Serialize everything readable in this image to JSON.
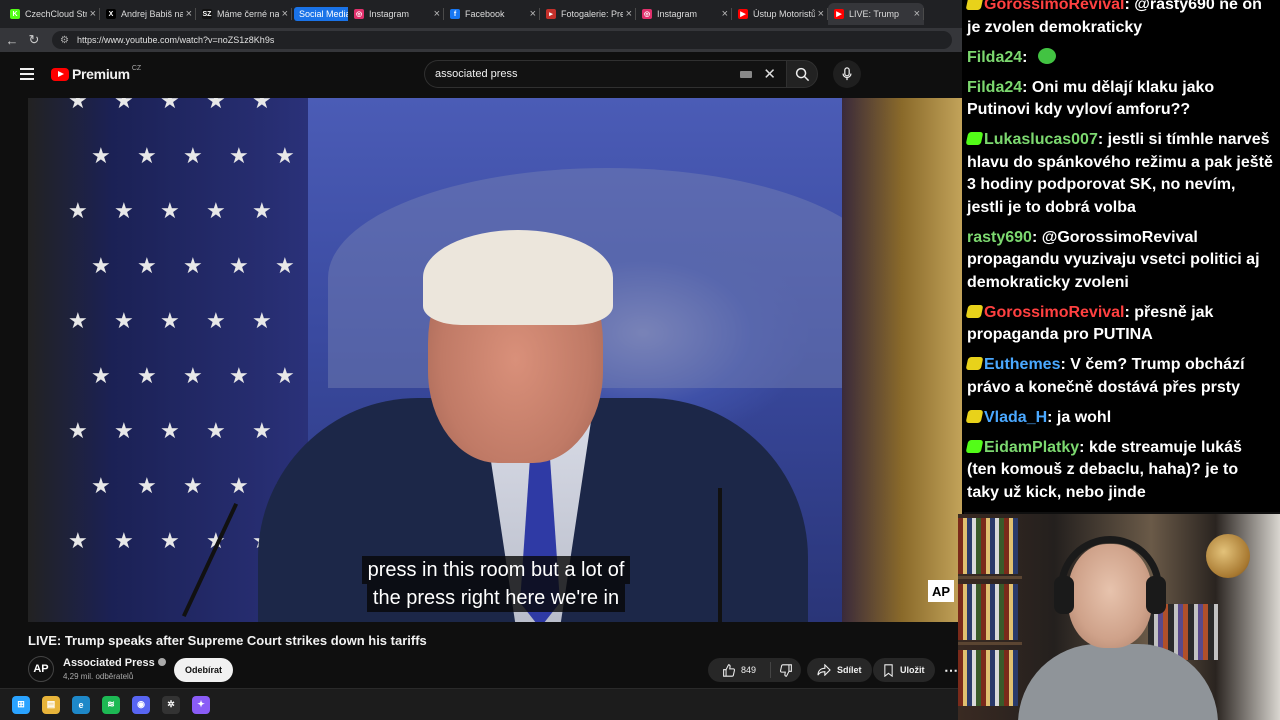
{
  "browser": {
    "tabs": [
      {
        "label": "CzechCloud Stre",
        "icon_color": "#53fc18",
        "glyph": "K"
      },
      {
        "label": "Andrej Babiš na",
        "icon_color": "#000000",
        "glyph": "X"
      },
      {
        "label": "Máme černé na",
        "icon_color": "#111111",
        "glyph": "SZ"
      },
      {
        "label": "Social Media",
        "group": true
      },
      {
        "label": "Instagram",
        "icon_color": "#e1306c",
        "glyph": "◎"
      },
      {
        "label": "Facebook",
        "icon_color": "#1877f2",
        "glyph": "f"
      },
      {
        "label": "Fotogalerie: Prez",
        "icon_color": "#c4302b",
        "glyph": "▸"
      },
      {
        "label": "Instagram",
        "icon_color": "#e1306c",
        "glyph": "◎"
      },
      {
        "label": "Ústup Motoristů",
        "icon_color": "#ff0000",
        "glyph": "▶"
      },
      {
        "label": "LIVE: Trump",
        "icon_color": "#ff0000",
        "glyph": "▶",
        "active": true
      }
    ],
    "url": "https://www.youtube.com/watch?v=noZS1z8Kh9s"
  },
  "youtube": {
    "logo": "Premium",
    "country": "CZ",
    "search_query": "associated press"
  },
  "video": {
    "captions": [
      "press in this room but a lot of",
      "the press right here we're in"
    ],
    "watermark": "AP",
    "title": "LIVE: Trump speaks after Supreme Court strikes down his tariffs"
  },
  "channel": {
    "avatar": "AP",
    "name": "Associated Press",
    "subscribers": "4,29 mil. odběratelů",
    "subscribe_label": "Odebírat"
  },
  "actions": {
    "likes": "849",
    "share": "Sdílet",
    "save": "Uložit",
    "more": "⋯"
  },
  "chat": [
    {
      "user": "GorossimoRevival",
      "color": "#ff4040",
      "badge": "#e8d21a",
      "text": "@rasty690 ne on je zvolen demokraticky"
    },
    {
      "user": "Filda24",
      "color": "#7cd86f",
      "text": "",
      "emote": true
    },
    {
      "user": "Filda24",
      "color": "#7cd86f",
      "text": "Oni mu dělají klaku jako Putinovi kdy vyloví amforu??"
    },
    {
      "user": "Lukaslucas007",
      "color": "#7cd86f",
      "badge": "#53fc18",
      "text": "jestli si tímhle narveš hlavu do spánkového režimu a pak ještě 3 hodiny podporovat SK, no nevím, jestli je to dobrá volba"
    },
    {
      "user": "rasty690",
      "color": "#7cd86f",
      "text": "@GorossimoRevival propagandu vyuzivaju vsetci politici aj demokraticky zvoleni"
    },
    {
      "user": "GorossimoRevival",
      "color": "#ff4040",
      "badge": "#e8d21a",
      "text": "přesně jak propaganda pro PUTINA"
    },
    {
      "user": "Euthemes",
      "color": "#4aa8ff",
      "badge": "#e8d21a",
      "text": "V čem? Trump obchází právo a konečně dostává přes prsty"
    },
    {
      "user": "Vlada_H",
      "color": "#4aa8ff",
      "badge": "#e8d21a",
      "text": "ja wohl"
    },
    {
      "user": "EidamPlatky",
      "color": "#7cd86f",
      "badge": "#53fc18",
      "text": "kde streamuje lukáš (ten komouš z debaclu, haha)? je to taky už kick, nebo jinde"
    }
  ],
  "taskbar": [
    {
      "name": "windows-start-icon",
      "color": "#2aa3ff",
      "glyph": "⊞"
    },
    {
      "name": "file-explorer-icon",
      "color": "#e8b43a",
      "glyph": "▤"
    },
    {
      "name": "edge-icon",
      "color": "#1e88c8",
      "glyph": "e"
    },
    {
      "name": "spotify-icon",
      "color": "#1db954",
      "glyph": "≋"
    },
    {
      "name": "discord-icon",
      "color": "#5865f2",
      "glyph": "◉"
    },
    {
      "name": "chatgpt-icon",
      "color": "#333333",
      "glyph": "✲"
    },
    {
      "name": "copilot-icon",
      "color": "#8a5cf6",
      "glyph": "✦"
    }
  ]
}
